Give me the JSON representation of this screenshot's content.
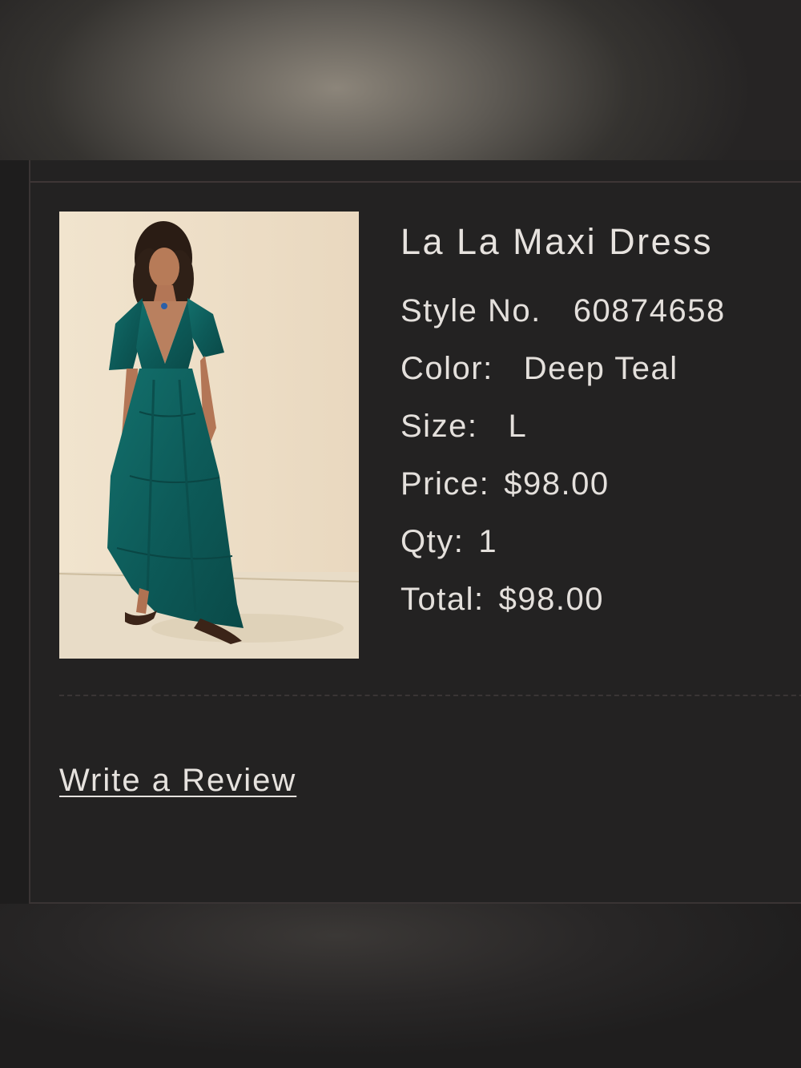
{
  "product": {
    "name": "La La Maxi Dress",
    "image_alt": "Model wearing La La Maxi Dress in Deep Teal"
  },
  "details": {
    "style": {
      "label": "Style No.",
      "value": "60874658"
    },
    "color": {
      "label": "Color:",
      "value": "Deep Teal"
    },
    "size": {
      "label": "Size:",
      "value": "L"
    },
    "price": {
      "label": "Price:",
      "value": "$98.00"
    },
    "qty": {
      "label": "Qty:",
      "value": "1"
    },
    "total": {
      "label": "Total:",
      "value": "$98.00"
    }
  },
  "actions": {
    "write_review": "Write a Review"
  },
  "colors": {
    "background": "#1e1d1d",
    "card": "#232222",
    "text": "#e4e0dc",
    "dress_teal": "#0f5a58"
  }
}
